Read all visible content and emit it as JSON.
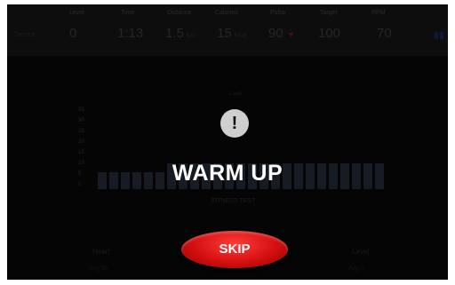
{
  "stats": {
    "row_label": "Session",
    "columns": [
      {
        "header": "Level",
        "value": "0",
        "unit": ""
      },
      {
        "header": "Time",
        "value": "1:13",
        "unit": ""
      },
      {
        "header": "Distance",
        "value": "1.5",
        "unit": "km"
      },
      {
        "header": "Calories",
        "value": "15",
        "unit": "kcal"
      },
      {
        "header": "Pulse",
        "value": "90",
        "unit": ""
      },
      {
        "header": "Target",
        "value": "100",
        "unit": ""
      },
      {
        "header": "RPM",
        "value": "70",
        "unit": ""
      }
    ]
  },
  "chart": {
    "yticks": [
      "35",
      "30",
      "25",
      "20",
      "15",
      "10",
      "5",
      "0"
    ],
    "label": "FITNESS TEST",
    "top_label": "Level"
  },
  "chart_data": {
    "type": "bar",
    "values": [
      2,
      2,
      2,
      2,
      2,
      2,
      3,
      3,
      3,
      3,
      3,
      3,
      3,
      3,
      3,
      3,
      3,
      3,
      3,
      3,
      3,
      3,
      3,
      3,
      3
    ],
    "ylim": [
      0,
      35
    ],
    "bar_color": "#171c24"
  },
  "overlay": {
    "alert_glyph": "!",
    "title": "WARM UP",
    "skip_label": "SKIP",
    "skip_color": "#d40f0f"
  },
  "bottom": {
    "left_label": "Heart",
    "left_sub": "Avg 90",
    "right_label": "Level",
    "right_sub": "Avg 0"
  },
  "icons": {
    "alert": "alert-icon",
    "heart": "heart-icon"
  }
}
